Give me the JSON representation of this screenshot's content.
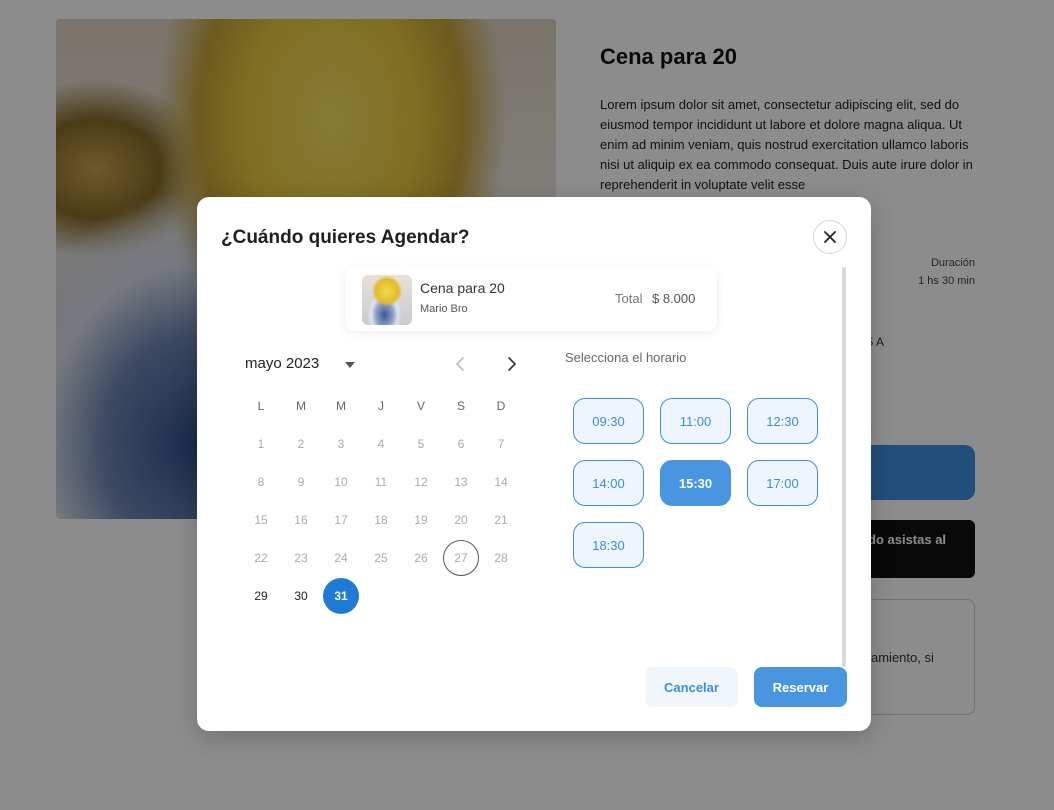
{
  "background": {
    "product_title": "Cena para 20",
    "description": "Lorem ipsum dolor sit amet, consectetur adipiscing elit, sed do eiusmod tempor incididunt ut labore et dolore magna aliqua. Ut enim ad minim veniam, quis nostrud exercitation ullamco laboris nisi ut aliquip ex ea commodo consequat. Duis aute irure dolor in reprehenderit in voluptate velit esse",
    "duration_label": "Duración",
    "duration_value": "1 hs 30 min",
    "address_fragment": ", 5 A",
    "black_button_fragment": "do asistas al",
    "card_fragment": "amiento, si"
  },
  "modal": {
    "title": "¿Cuándo quieres Agendar?",
    "summary": {
      "name": "Cena para 20",
      "vendor": "Mario Bro",
      "total_label": "Total",
      "total_value": "$ 8.000"
    },
    "calendar": {
      "month_label": "mayo 2023",
      "weekdays": [
        "L",
        "M",
        "M",
        "J",
        "V",
        "S",
        "D"
      ],
      "weeks": [
        [
          "1",
          "2",
          "3",
          "4",
          "5",
          "6",
          "7"
        ],
        [
          "8",
          "9",
          "10",
          "11",
          "12",
          "13",
          "14"
        ],
        [
          "15",
          "16",
          "17",
          "18",
          "19",
          "20",
          "21"
        ],
        [
          "22",
          "23",
          "24",
          "25",
          "26",
          "27",
          "28"
        ],
        [
          "29",
          "30",
          "31",
          "",
          "",
          "",
          ""
        ]
      ],
      "today": "27",
      "selected": "31"
    },
    "schedule": {
      "title": "Selecciona el horario",
      "slots": [
        "09:30",
        "11:00",
        "12:30",
        "14:00",
        "15:30",
        "17:00",
        "18:30"
      ],
      "selected_slot": "15:30"
    },
    "actions": {
      "cancel_label": "Cancelar",
      "book_label": "Reservar"
    }
  }
}
